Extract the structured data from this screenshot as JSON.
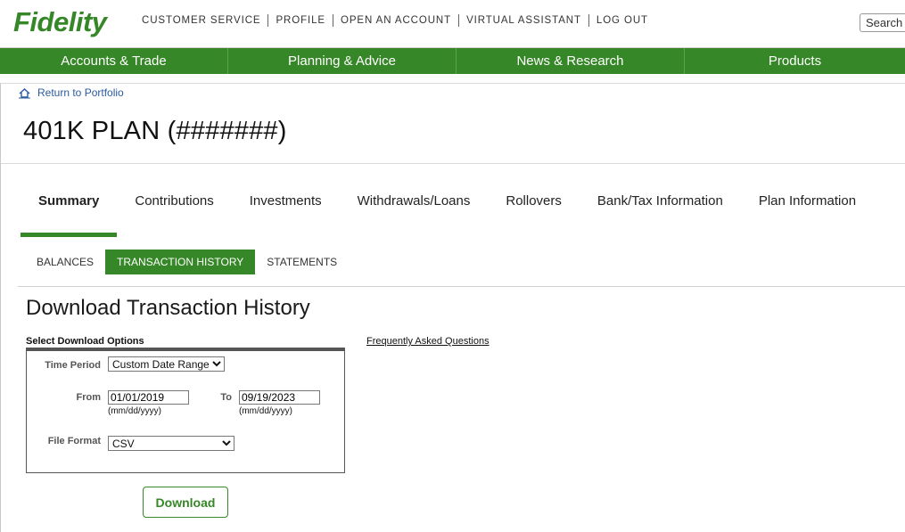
{
  "header": {
    "logo_text": "Fidelity",
    "brand_color": "#368727",
    "utility_links": [
      "CUSTOMER SERVICE",
      "PROFILE",
      "OPEN AN ACCOUNT",
      "VIRTUAL ASSISTANT",
      "LOG OUT"
    ],
    "search_placeholder": "Search"
  },
  "main_nav": [
    "Accounts & Trade",
    "Planning & Advice",
    "News & Research",
    "Products"
  ],
  "back_link": "Return to Portfolio",
  "account_title": "401K PLAN (#######)",
  "tabs": [
    {
      "label": "Summary",
      "active": true
    },
    {
      "label": "Contributions",
      "active": false
    },
    {
      "label": "Investments",
      "active": false
    },
    {
      "label": "Withdrawals/Loans",
      "active": false
    },
    {
      "label": "Rollovers",
      "active": false
    },
    {
      "label": "Bank/Tax Information",
      "active": false
    },
    {
      "label": "Plan Information",
      "active": false
    }
  ],
  "subtabs": [
    {
      "label": "BALANCES",
      "active": false
    },
    {
      "label": "TRANSACTION HISTORY",
      "active": true
    },
    {
      "label": "STATEMENTS",
      "active": false
    }
  ],
  "section_title": "Download Transaction History",
  "form": {
    "options_label": "Select Download Options",
    "faq_link": "Frequently Asked Questions",
    "time_period_label": "Time Period",
    "time_period_value": "Custom Date Range",
    "from_label": "From",
    "from_value": "01/01/2019",
    "to_label": "To",
    "to_value": "09/19/2023",
    "date_hint": "(mm/dd/yyyy)",
    "file_format_label": "File Format",
    "file_format_value": "CSV",
    "download_label": "Download"
  }
}
